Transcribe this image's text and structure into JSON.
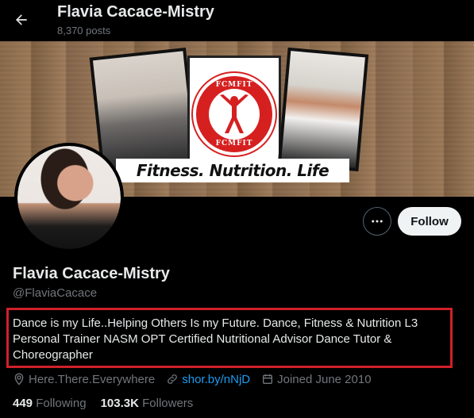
{
  "header": {
    "title": "Flavia Cacace-Mistry",
    "post_count": "8,370 posts"
  },
  "banner": {
    "logo_top_text": "FCMFIT",
    "logo_bottom_text": "FCMFIT",
    "tagline": "Fitness. Nutrition. Life"
  },
  "actions": {
    "follow_label": "Follow"
  },
  "profile": {
    "name": "Flavia Cacace-Mistry",
    "handle": "@FlaviaCacace",
    "bio": "Dance is my Life..Helping Others Is my Future. Dance, Fitness & Nutrition L3 Personal Trainer NASM OPT Certified Nutritional Advisor Dance Tutor & Choreographer",
    "location": "Here.There.Everywhere",
    "website": "shor.by/nNjD",
    "joined": "Joined June 2010"
  },
  "stats": {
    "following_count": "449",
    "following_label": "Following",
    "followers_count": "103.3K",
    "followers_label": "Followers"
  },
  "colors": {
    "highlight_border": "#d0202a",
    "link": "#1d9bf0",
    "muted": "#71767b"
  }
}
